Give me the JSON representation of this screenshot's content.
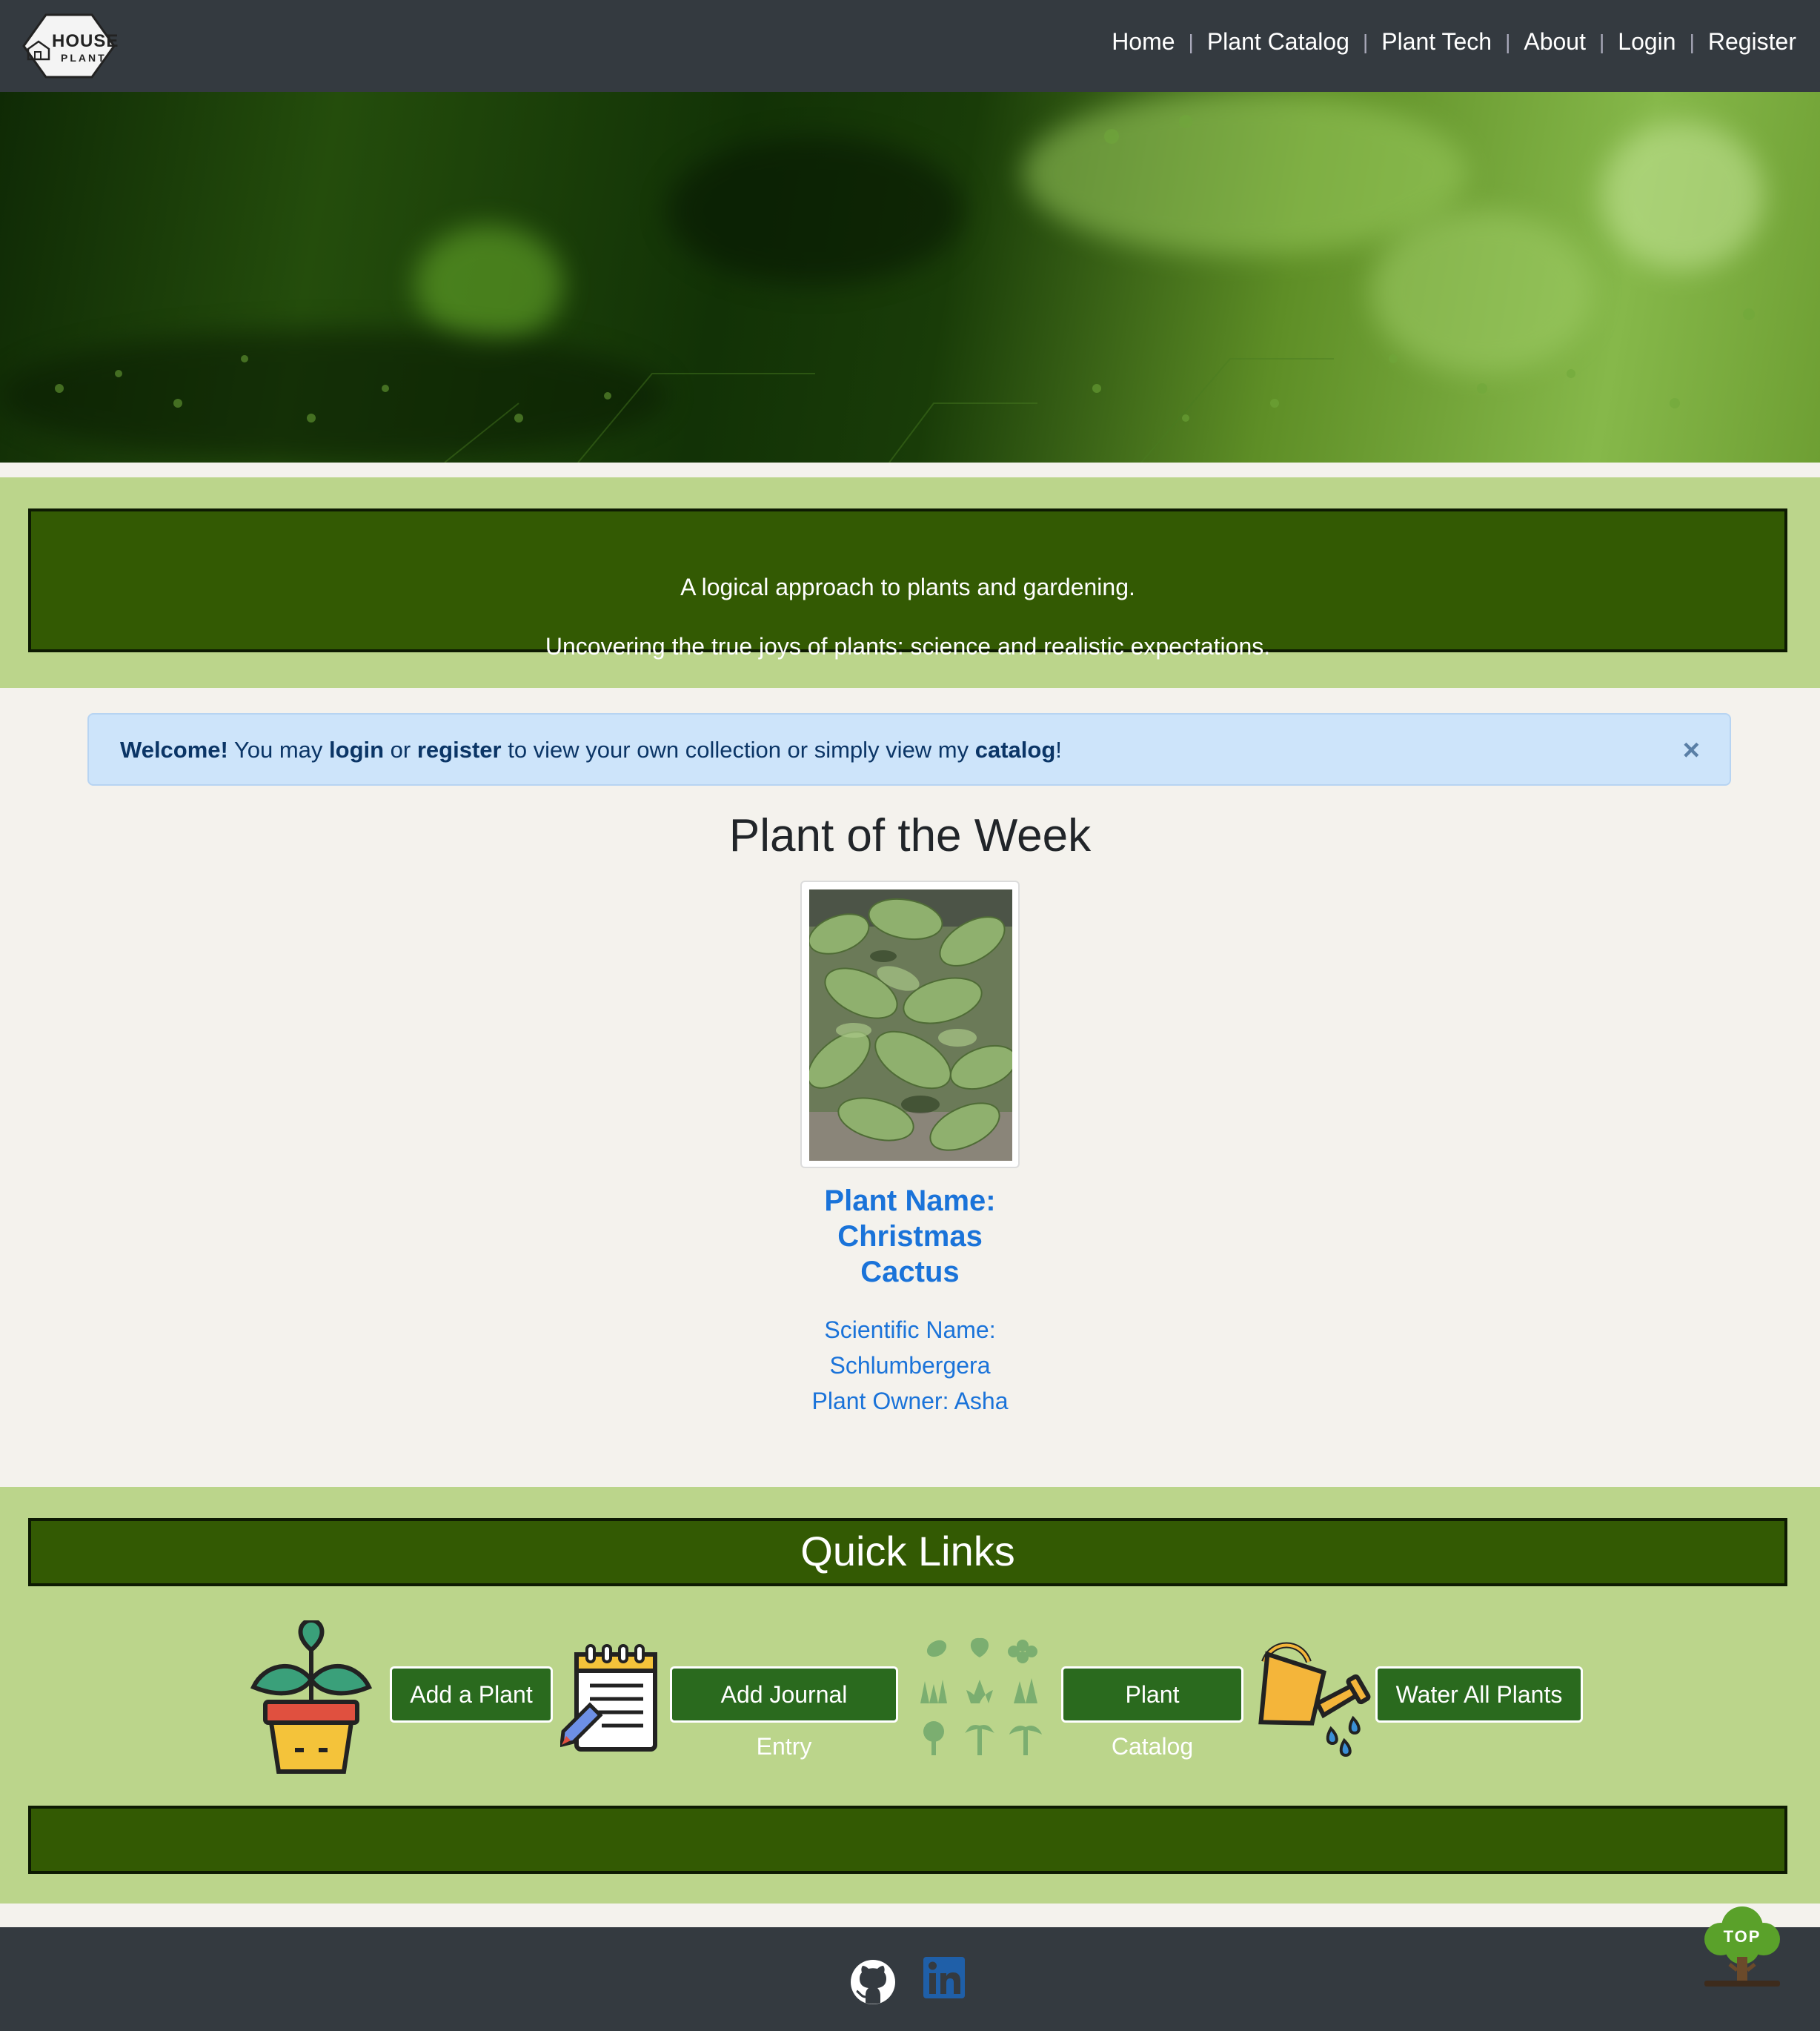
{
  "logo": {
    "line1": "HOUSE",
    "line2": "PLANT"
  },
  "nav": {
    "items": [
      "Home",
      "Plant Catalog",
      "Plant Tech",
      "About",
      "Login",
      "Register"
    ],
    "separator": "|"
  },
  "tagline": {
    "line1": "A logical approach to plants and gardening.",
    "line2": "Uncovering the true joys of plants: science and realistic expectations."
  },
  "alert": {
    "welcome": "Welcome!",
    "t1": " You may ",
    "login": "login",
    "t2": " or ",
    "register": "register",
    "t3": " to view your own collection or simply view my ",
    "catalog": "catalog",
    "t4": "!",
    "close": "×"
  },
  "plant_of_week": {
    "title": "Plant of the Week",
    "name_lines": [
      "Plant Name:",
      "Christmas",
      "Cactus"
    ],
    "sci_lines": [
      "Scientific Name:",
      "Schlumbergera",
      "Plant Owner: Asha"
    ]
  },
  "quick_links": {
    "title": "Quick Links",
    "buttons": [
      "Add a Plant",
      "Add Journal Entry",
      "Plant Catalog",
      "Water All Plants"
    ]
  },
  "top_button": {
    "label": "TOP"
  },
  "colors": {
    "navbar": "#343a40",
    "band_green": "#bbd58b",
    "box_green": "#335a03",
    "button_green": "#2a6a1e",
    "link_blue": "#1a73d9",
    "alert_bg": "#cde4fa"
  }
}
